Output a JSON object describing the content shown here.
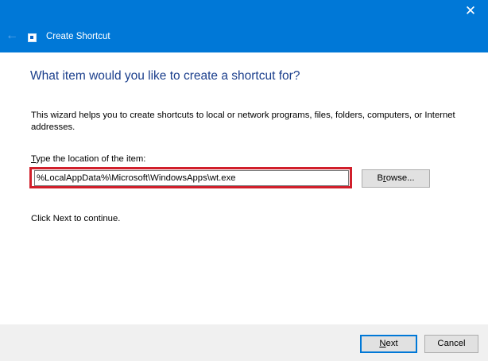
{
  "window": {
    "title": "Create Shortcut",
    "close_glyph": "✕",
    "back_glyph": "←",
    "accent_color": "#0078d7",
    "icons": [
      "back-arrow-icon",
      "shortcut-app-icon",
      "close-icon"
    ]
  },
  "wizard": {
    "heading": "What item would you like to create a shortcut for?",
    "description": "This wizard helps you to create shortcuts to local or network programs, files, folders, computers, or Internet addresses.",
    "location_label_mnemonic": "T",
    "location_label_rest": "ype the location of the item:",
    "location_value": "%LocalAppData%\\Microsoft\\WindowsApps\\wt.exe",
    "browse_label_pre": "B",
    "browse_label_mnemonic": "r",
    "browse_label_post": "owse...",
    "continue_text": "Click Next to continue.",
    "highlight_color": "#d11f2b"
  },
  "footer": {
    "next_label_mnemonic": "N",
    "next_label_rest": "ext",
    "cancel_label": "Cancel"
  }
}
